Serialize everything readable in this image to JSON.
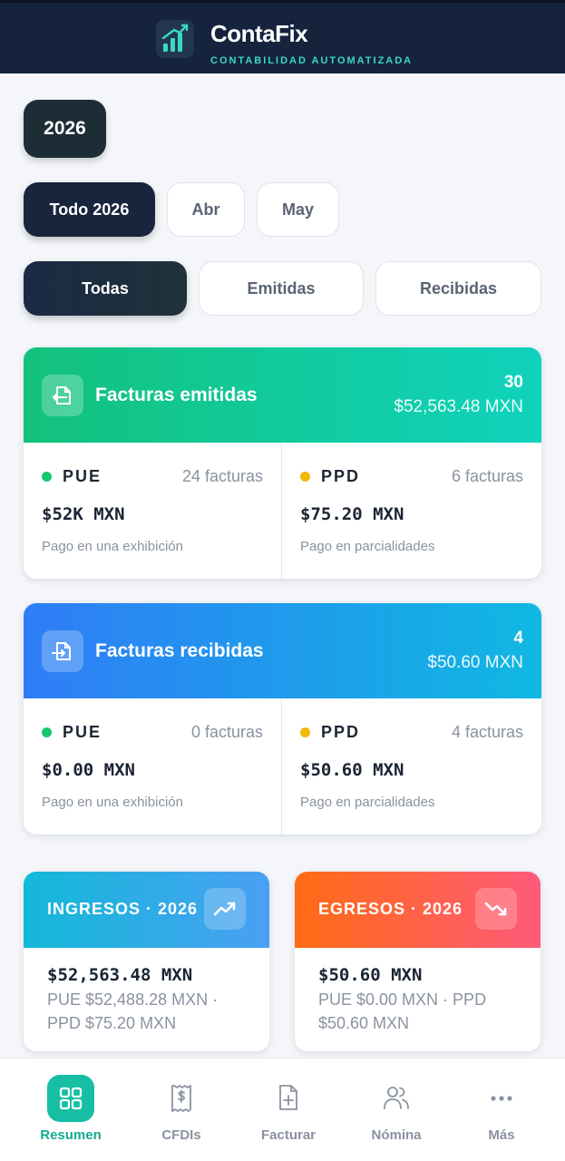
{
  "header": {
    "brand": "ContaFix",
    "tagline": "CONTABILIDAD AUTOMATIZADA",
    "logo_icon": "bar-chart-growth-icon"
  },
  "year_selector": {
    "label": "2026"
  },
  "period_tabs": [
    {
      "label": "Todo 2026",
      "active": true
    },
    {
      "label": "Abr",
      "active": false
    },
    {
      "label": "May",
      "active": false
    }
  ],
  "type_tabs": [
    {
      "label": "Todas",
      "active": true
    },
    {
      "label": "Emitidas",
      "active": false
    },
    {
      "label": "Recibidas",
      "active": false
    }
  ],
  "emitidas": {
    "title": "Facturas emitidas",
    "count": "30",
    "total": "$52,563.48 MXN",
    "icon": "file-export-icon",
    "pue": {
      "label": "PUE",
      "count": "24 facturas",
      "amount": "$52K MXN",
      "desc": "Pago en una exhibición"
    },
    "ppd": {
      "label": "PPD",
      "count": "6 facturas",
      "amount": "$75.20 MXN",
      "desc": "Pago en parcialidades"
    }
  },
  "recibidas": {
    "title": "Facturas recibidas",
    "count": "4",
    "total": "$50.60 MXN",
    "icon": "file-import-icon",
    "pue": {
      "label": "PUE",
      "count": "0 facturas",
      "amount": "$0.00 MXN",
      "desc": "Pago en una exhibición"
    },
    "ppd": {
      "label": "PPD",
      "count": "4 facturas",
      "amount": "$50.60 MXN",
      "desc": "Pago en parcialidades"
    }
  },
  "ingresos": {
    "title": "INGRESOS · 2026",
    "amount": "$52,563.48 MXN",
    "detail": "PUE $52,488.28 MXN · PPD $75.20 MXN",
    "icon": "trending-up-icon"
  },
  "egresos": {
    "title": "EGRESOS · 2026",
    "amount": "$50.60 MXN",
    "detail": "PUE $0.00 MXN · PPD $50.60 MXN",
    "icon": "trending-down-icon"
  },
  "bottom_nav": [
    {
      "label": "Resumen",
      "icon": "dashboard-grid-icon",
      "active": true
    },
    {
      "label": "CFDIs",
      "icon": "receipt-dollar-icon",
      "active": false
    },
    {
      "label": "Facturar",
      "icon": "file-plus-icon",
      "active": false
    },
    {
      "label": "Nómina",
      "icon": "users-icon",
      "active": false
    },
    {
      "label": "Más",
      "icon": "more-dots-icon",
      "active": false
    }
  ],
  "colors": {
    "header_bg": "#15233d",
    "accent_teal": "#16bfa4",
    "emitidas_gradient": [
      "#13c17b",
      "#10d3bd"
    ],
    "recibidas_gradient": [
      "#2f7df6",
      "#10b8e2"
    ],
    "ingresos_gradient": [
      "#13b8d8",
      "#4aa0f3"
    ],
    "egresos_gradient": [
      "#ff6b14",
      "#ff5a7b"
    ],
    "pue_dot": "#18c66e",
    "ppd_dot": "#f2b80b"
  }
}
